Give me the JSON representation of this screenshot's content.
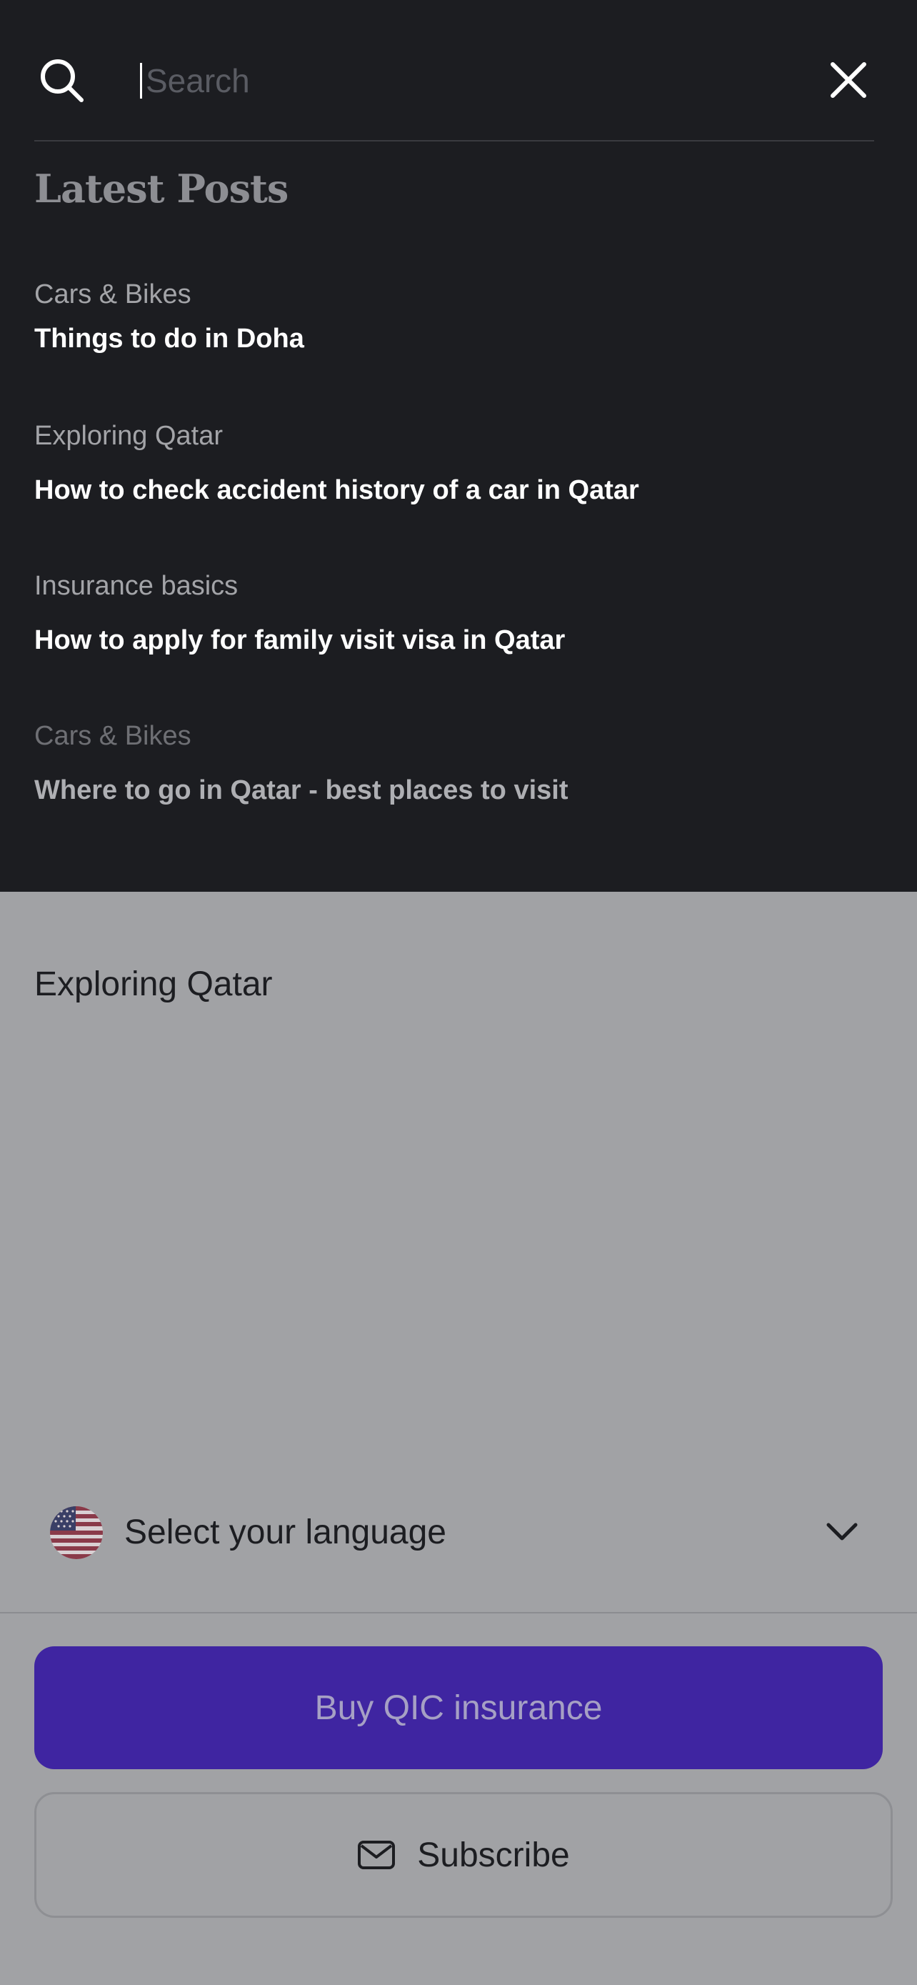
{
  "search": {
    "placeholder": "Search"
  },
  "latest_posts": {
    "title": "Latest Posts",
    "items": [
      {
        "category": "Cars & Bikes",
        "title": "Things to do in Doha"
      },
      {
        "category": "Exploring Qatar",
        "title": "How to check accident history of a car in Qatar"
      },
      {
        "category": "Insurance basics",
        "title": "How to apply for family visit visa in Qatar"
      },
      {
        "category": "Cars & Bikes",
        "title": "Where to go in Qatar - best places to visit"
      }
    ]
  },
  "page": {
    "heading": "Exploring Qatar"
  },
  "language": {
    "label": "Select your language",
    "flag_icon": "us-flag-icon"
  },
  "actions": {
    "buy_label": "Buy QIC insurance",
    "subscribe_label": "Subscribe"
  },
  "colors": {
    "overlay_background": "#1c1d21",
    "page_background": "#a1a2a5",
    "primary_button": "#3f25a1"
  }
}
